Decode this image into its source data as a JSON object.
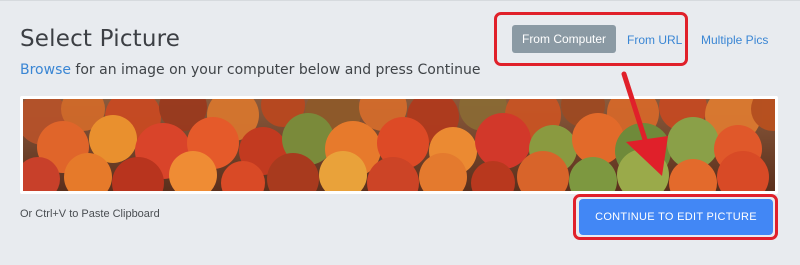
{
  "header": {
    "title": "Select Picture",
    "subtitle_link": "Browse",
    "subtitle_rest": " for an image on your computer below and press Continue"
  },
  "source_tabs": [
    {
      "label": "From Computer",
      "active": true
    },
    {
      "label": "From URL",
      "active": false
    },
    {
      "label": "Multiple Pics",
      "active": false
    }
  ],
  "preview": {
    "icon": "autumn-forest-photo"
  },
  "paste_hint": "Or Ctrl+V to Paste Clipboard",
  "continue_button": {
    "label": "CONTINUE TO EDIT PICTURE"
  },
  "colors": {
    "accent": "#4287f5",
    "link": "#3a86d4",
    "highlight": "#e0202a",
    "active_tab": "#8b9aa4"
  }
}
